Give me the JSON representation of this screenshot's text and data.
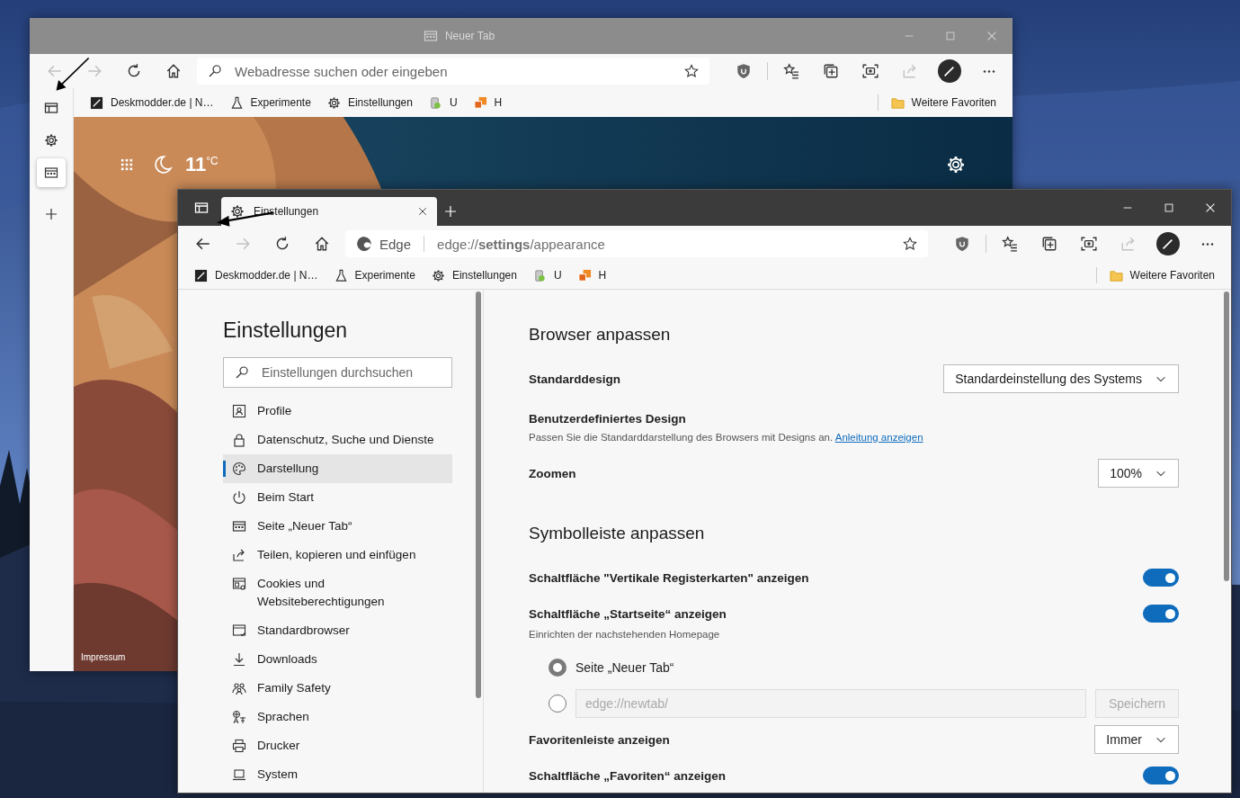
{
  "back_window": {
    "title": "Neuer Tab",
    "back_disabled": true,
    "address": {
      "placeholder": "Webadresse suchen oder eingeben"
    },
    "bookmarks": [
      "Deskmodder.de | N…",
      "Experimente",
      "Einstellungen",
      "U",
      "H"
    ],
    "more_favorites": "Weitere Favoriten",
    "vertical_tabs": [
      {
        "selected": false
      },
      {
        "selected": true
      }
    ],
    "weather": {
      "temperature": "11",
      "unit": "°C"
    },
    "footer_link": "Impressum"
  },
  "front_window": {
    "tabs": [
      {
        "label": "Einstellungen",
        "selected": true
      }
    ],
    "back_disabled": false,
    "address": {
      "site": "Edge",
      "url": "edge://**settings**/appearance"
    },
    "bookmarks": [
      "Deskmodder.de | N…",
      "Experimente",
      "Einstellungen",
      "U",
      "H"
    ],
    "more_favorites": "Weitere Favoriten",
    "settings_nav": {
      "title": "Einstellungen",
      "search_placeholder": "Einstellungen durchsuchen",
      "items": [
        {
          "label": "Profile",
          "selected": false
        },
        {
          "label": "Datenschutz, Suche und Dienste",
          "selected": false
        },
        {
          "label": "Darstellung",
          "selected": true
        },
        {
          "label": "Beim Start",
          "selected": false
        },
        {
          "label": "Seite „Neuer Tab“",
          "selected": false
        },
        {
          "label": "Teilen, kopieren und einfügen",
          "selected": false
        },
        {
          "label": "Cookies und Websiteberechtigungen",
          "selected": false
        },
        {
          "label": "Standardbrowser",
          "selected": false
        },
        {
          "label": "Downloads",
          "selected": false
        },
        {
          "label": "Family Safety",
          "selected": false
        },
        {
          "label": "Sprachen",
          "selected": false
        },
        {
          "label": "Drucker",
          "selected": false
        },
        {
          "label": "System",
          "selected": false
        }
      ]
    },
    "sections": [
      {
        "heading": "Browser anpassen",
        "rows": [
          {
            "kind": "select",
            "label": "Standarddesign",
            "value": "Standardeinstellung des Systems"
          },
          {
            "kind": "info",
            "label": "Benutzerdefiniertes Design",
            "description": "Passen Sie die Standarddarstellung des Browsers mit Designs an.",
            "link": "Anleitung anzeigen"
          },
          {
            "kind": "select",
            "label": "Zoomen",
            "value": "100%"
          }
        ]
      },
      {
        "heading": "Symbolleiste anpassen",
        "rows": [
          {
            "kind": "toggle",
            "label": "Schaltfläche \"Vertikale Registerkarten\" anzeigen",
            "on": true
          },
          {
            "kind": "toggle",
            "label": "Schaltfläche „Startseite“ anzeigen",
            "on": true,
            "description": "Einrichten der nachstehenden Homepage"
          },
          {
            "kind": "radio",
            "label": "Seite „Neuer Tab“",
            "selected": true
          },
          {
            "kind": "radio_field",
            "selected": false,
            "placeholder": "edge://newtab/",
            "button": "Speichern",
            "disabled": true
          },
          {
            "kind": "select",
            "label": "Favoritenleiste anzeigen",
            "value": "Immer"
          },
          {
            "kind": "toggle",
            "label": "Schaltfläche „Favoriten“ anzeigen",
            "on": true
          }
        ]
      }
    ]
  }
}
